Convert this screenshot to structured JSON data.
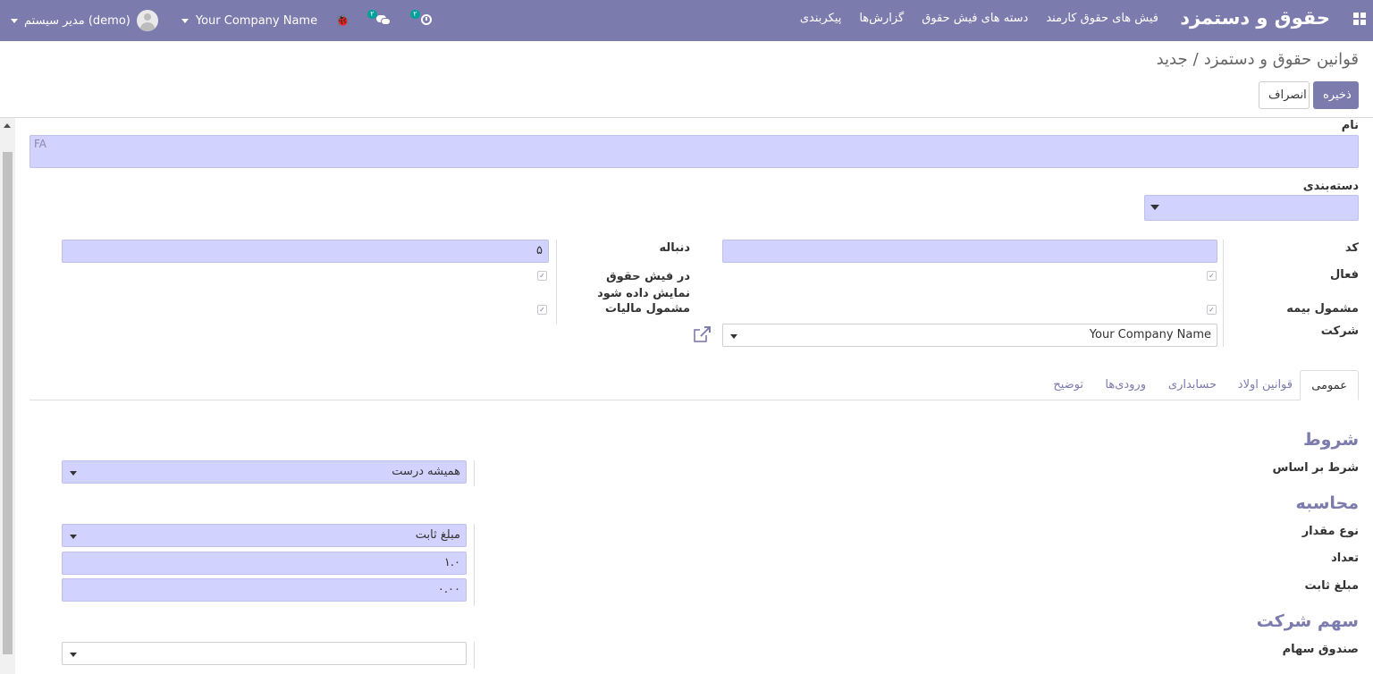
{
  "navbar": {
    "app_title": "حقوق و دستمزد",
    "menu": [
      "فیش های حقوق کارمند",
      "دسته های فیش حقوق",
      "گزارش‌ها",
      "پیکربندی"
    ],
    "company": "Your Company Name",
    "user": "مدیر سیستم (demo)",
    "messages_count": "۲",
    "activities_count": "۲"
  },
  "breadcrumb": {
    "parent": "قوانین حقوق و دستمزد",
    "separator": "/",
    "current": "جدید"
  },
  "buttons": {
    "save": "ذخیره",
    "discard": "انصراف"
  },
  "form": {
    "name": {
      "label": "نام",
      "value": "FA"
    },
    "category": {
      "label": "دسته‌بندی",
      "value": ""
    },
    "code": {
      "label": "کد",
      "value": ""
    },
    "sequence": {
      "label": "دنباله",
      "value": "۵"
    },
    "active": {
      "label": "فعال",
      "checked": true
    },
    "appears_on_payslip": {
      "label": "در فیش حقوق نمایش داده شود",
      "checked": true
    },
    "insurance": {
      "label": "مشمول بیمه",
      "checked": true
    },
    "taxable": {
      "label": "مشمول مالیات",
      "checked": true
    },
    "company": {
      "label": "شرکت",
      "value": "Your Company Name"
    }
  },
  "tabs": [
    "عمومی",
    "قوانین اولاد",
    "حسابداری",
    "ورودی‌ها",
    "توضیح"
  ],
  "active_tab": "عمومی",
  "general": {
    "conditions": {
      "title": "شروط",
      "condition_label": "شرط بر اساس",
      "condition_value": "همیشه درست"
    },
    "computation": {
      "title": "محاسبه",
      "amount_type_label": "نوع مقدار",
      "amount_type_value": "مبلغ ثابت",
      "quantity_label": "تعداد",
      "quantity_value": "۱.۰",
      "fixed_amount_label": "مبلغ ثابت",
      "fixed_amount_value": "۰.۰۰"
    },
    "company_contribution": {
      "title": "سهم شرکت",
      "fund_label": "صندوق سهام",
      "fund_value": ""
    }
  },
  "colors": {
    "primary": "#7c7bad",
    "input_bg": "#d2d2ff"
  }
}
